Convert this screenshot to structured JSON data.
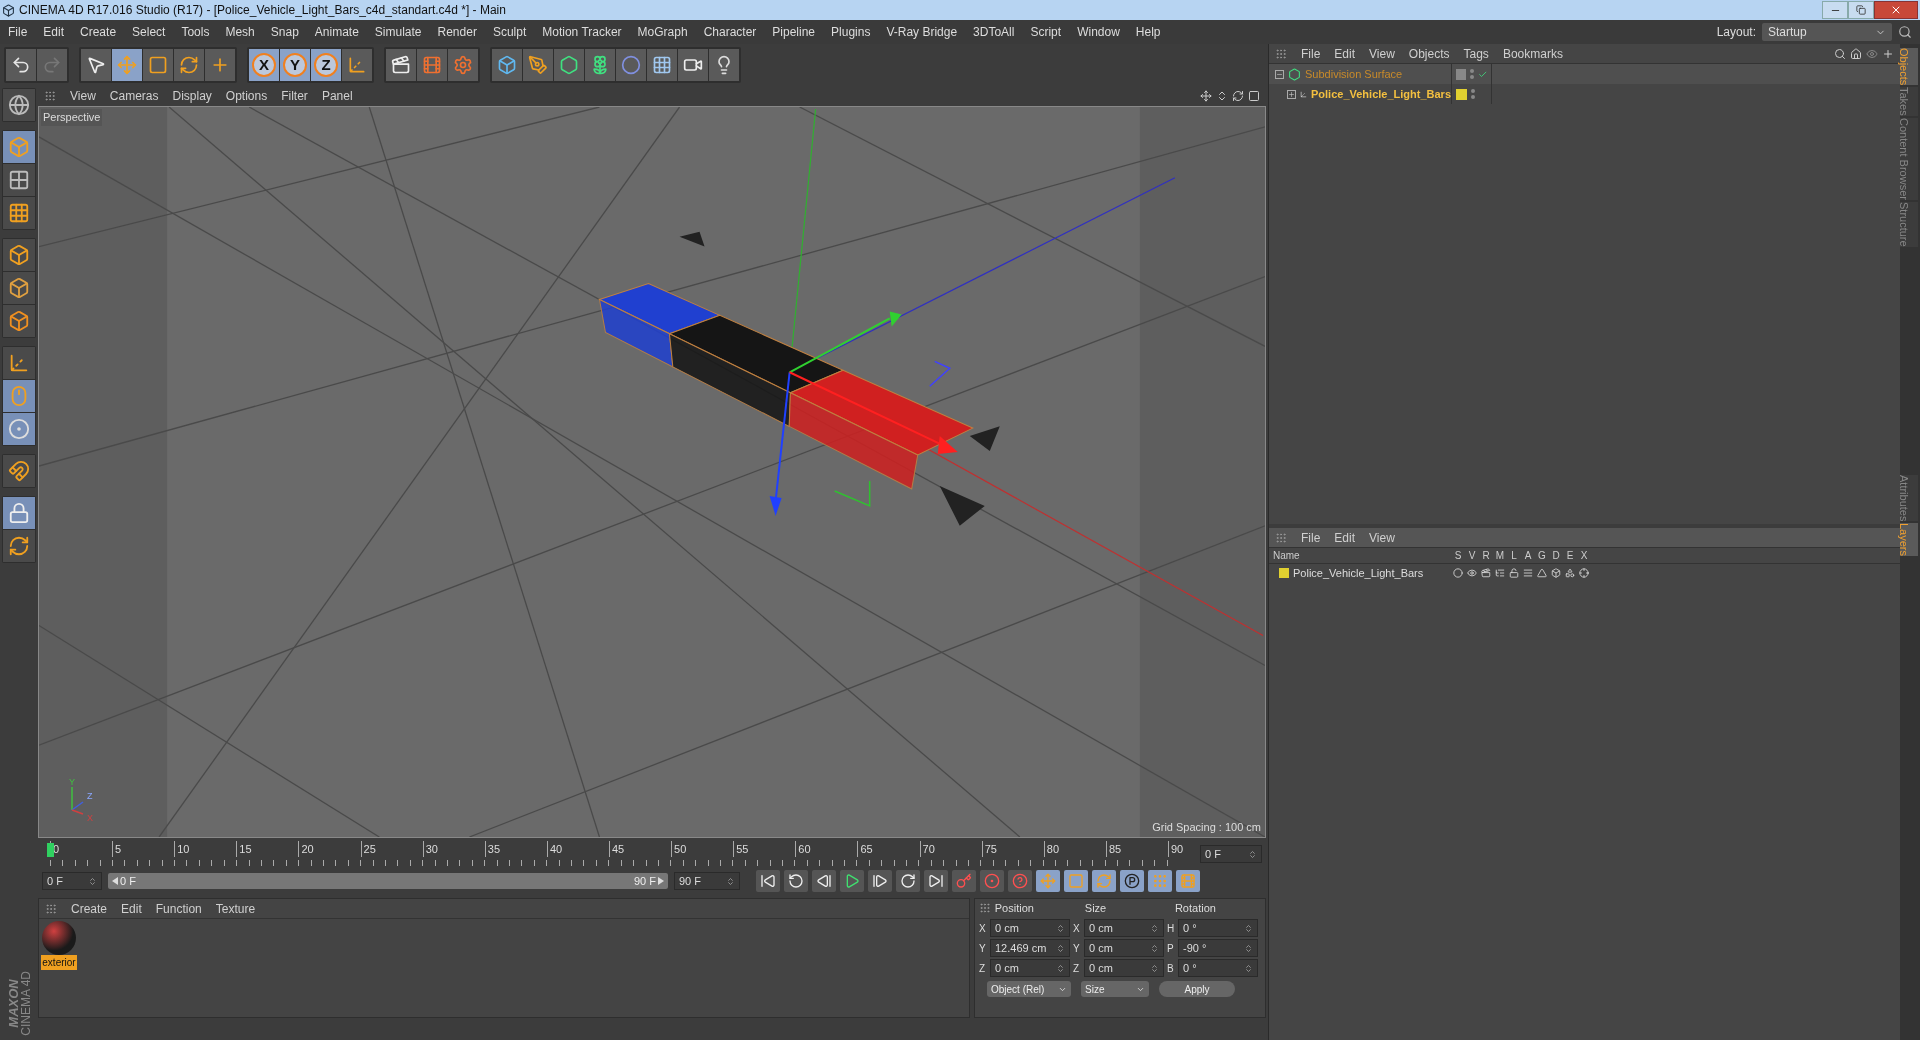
{
  "window": {
    "title": "CINEMA 4D R17.016 Studio (R17) - [Police_Vehicle_Light_Bars_c4d_standart.c4d *] - Main"
  },
  "menu": [
    "File",
    "Edit",
    "Create",
    "Select",
    "Tools",
    "Mesh",
    "Snap",
    "Animate",
    "Simulate",
    "Render",
    "Sculpt",
    "Motion Tracker",
    "MoGraph",
    "Character",
    "Pipeline",
    "Plugins",
    "V-Ray Bridge",
    "3DToAll",
    "Script",
    "Window",
    "Help"
  ],
  "layout": {
    "label": "Layout:",
    "value": "Startup"
  },
  "toolbar": [
    [
      {
        "kind": "undo",
        "selected": false
      },
      {
        "kind": "redo",
        "selected": false
      }
    ],
    [
      {
        "kind": "select",
        "selected": false
      },
      {
        "kind": "move",
        "selected": true
      },
      {
        "kind": "scale",
        "selected": false
      },
      {
        "kind": "rotate",
        "selected": false
      },
      {
        "kind": "transform",
        "selected": false
      }
    ],
    [
      {
        "kind": "axis",
        "label": "X",
        "selected": true
      },
      {
        "kind": "axis",
        "label": "Y",
        "selected": true
      },
      {
        "kind": "axis",
        "label": "Z",
        "selected": true
      },
      {
        "kind": "coords",
        "selected": false
      }
    ],
    [
      {
        "kind": "render-view",
        "selected": false
      },
      {
        "kind": "render-picture",
        "selected": false
      },
      {
        "kind": "render-settings",
        "selected": false
      }
    ],
    [
      {
        "kind": "cube",
        "selected": false
      },
      {
        "kind": "pen",
        "selected": false
      },
      {
        "kind": "subdivision",
        "selected": false
      },
      {
        "kind": "cloner",
        "selected": false
      },
      {
        "kind": "deformer",
        "selected": false
      },
      {
        "kind": "floor",
        "selected": false
      },
      {
        "kind": "camera",
        "selected": false
      },
      {
        "kind": "light",
        "selected": false
      }
    ]
  ],
  "left_tools": [
    [
      {
        "kind": "globe",
        "selected": false
      }
    ],
    [
      {
        "kind": "model",
        "selected": true
      },
      {
        "kind": "checker",
        "selected": false
      },
      {
        "kind": "grid",
        "selected": false
      }
    ],
    [
      {
        "kind": "points",
        "selected": false
      },
      {
        "kind": "edges",
        "selected": false
      },
      {
        "kind": "polygons",
        "selected": false
      }
    ],
    [
      {
        "kind": "axis",
        "selected": false
      },
      {
        "kind": "mouse",
        "selected": true
      },
      {
        "kind": "sphere",
        "selected": true
      }
    ],
    [
      {
        "kind": "magnet",
        "selected": false
      }
    ],
    [
      {
        "kind": "lock-grid",
        "selected": true
      },
      {
        "kind": "sync-grid",
        "selected": false
      }
    ]
  ],
  "brand": [
    "MAXON",
    "CINEMA 4D"
  ],
  "viewport": {
    "menu": [
      "View",
      "Cameras",
      "Display",
      "Options",
      "Filter",
      "Panel"
    ],
    "label": "Perspective",
    "grid_spacing": "Grid Spacing : 100 cm",
    "axis_labels": [
      "Y",
      "Z",
      "X"
    ]
  },
  "timeline": {
    "ticks": [
      "0",
      "5",
      "10",
      "15",
      "20",
      "25",
      "30",
      "35",
      "40",
      "45",
      "50",
      "55",
      "60",
      "65",
      "70",
      "75",
      "80",
      "85",
      "90"
    ],
    "current_frame": "0 F",
    "start": "0 F",
    "range_start": "0 F",
    "range_end": "90 F",
    "level": 1,
    "end": "90 F"
  },
  "transport": [
    {
      "kind": "first",
      "selected": false
    },
    {
      "kind": "prev-key",
      "selected": false
    },
    {
      "kind": "prev-frame",
      "selected": false
    },
    {
      "kind": "play",
      "selected": false
    },
    {
      "kind": "next-frame",
      "selected": false
    },
    {
      "kind": "next-key",
      "selected": false
    },
    {
      "kind": "last",
      "selected": false
    },
    {
      "kind": "record",
      "selected": false
    },
    {
      "kind": "auto-key",
      "selected": false
    },
    {
      "kind": "keyframe-help",
      "selected": false
    },
    {
      "kind": "key-move",
      "selected": true
    },
    {
      "kind": "key-scale",
      "selected": true
    },
    {
      "kind": "key-rotate",
      "selected": true
    },
    {
      "kind": "key-param",
      "selected": true
    },
    {
      "kind": "key-points",
      "selected": true
    },
    {
      "kind": "timeline",
      "selected": true
    }
  ],
  "materials": {
    "menu": [
      "Create",
      "Edit",
      "Function",
      "Texture"
    ],
    "items": [
      {
        "name": "exterior",
        "selected": true
      }
    ]
  },
  "coordinates": {
    "headers": [
      "Position",
      "Size",
      "Rotation"
    ],
    "rows": [
      {
        "pos_label": "X",
        "position": "0 cm",
        "size_label": "X",
        "size": "0 cm",
        "rot_label": "H",
        "rotation": "0 °"
      },
      {
        "pos_label": "Y",
        "position": "12.469 cm",
        "size_label": "Y",
        "size": "0 cm",
        "rot_label": "P",
        "rotation": "-90 °"
      },
      {
        "pos_label": "Z",
        "position": "0 cm",
        "size_label": "Z",
        "size": "0 cm",
        "rot_label": "B",
        "rotation": "0 °"
      }
    ],
    "mode": "Object (Rel)",
    "size_mode": "Size",
    "apply": "Apply"
  },
  "objects": {
    "menu": [
      "File",
      "Edit",
      "View",
      "Objects",
      "Tags",
      "Bookmarks"
    ],
    "items": [
      {
        "name": "Subdivision Surface",
        "kind": "subdivision",
        "expanded": true,
        "children": [
          {
            "name": "Police_Vehicle_Light_Bars",
            "kind": "null",
            "expanded": false,
            "color": "#e0d030"
          }
        ]
      }
    ]
  },
  "layers": {
    "menu": [
      "File",
      "Edit",
      "View"
    ],
    "columns": [
      "Name",
      "S",
      "V",
      "R",
      "M",
      "L",
      "A",
      "G",
      "D",
      "E",
      "X"
    ],
    "rows": [
      {
        "name": "Police_Vehicle_Light_Bars",
        "color": "#e0d030"
      }
    ]
  },
  "side_tabs_top": [
    {
      "label": "Objects",
      "selected": true
    },
    {
      "label": "Takes",
      "selected": false
    },
    {
      "label": "Content Browser",
      "selected": false
    },
    {
      "label": "Structure",
      "selected": false
    }
  ],
  "side_tabs_bottom": [
    {
      "label": "Attributes",
      "selected": false
    },
    {
      "label": "Layers",
      "selected": true
    }
  ]
}
